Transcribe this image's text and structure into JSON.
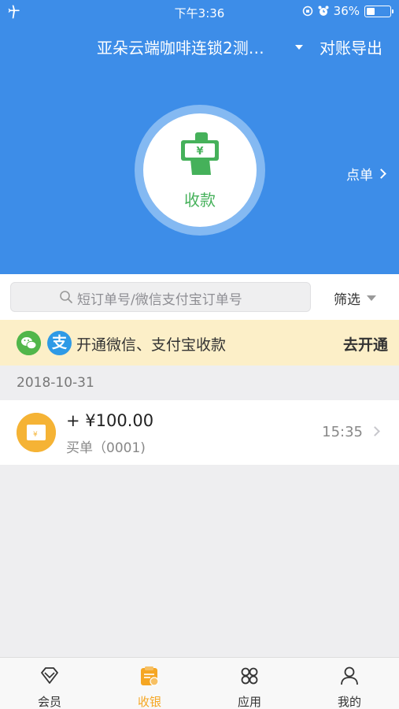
{
  "status_bar": {
    "time": "下午3:36",
    "battery": "36%"
  },
  "header": {
    "store_name": "亚朵云端咖啡连锁2测…",
    "export_label": "对账导出"
  },
  "collect": {
    "label": "收款"
  },
  "order_link": {
    "label": "点单"
  },
  "search": {
    "placeholder": "短订单号/微信支付宝订单号",
    "filter_label": "筛选"
  },
  "banner": {
    "text": "开通微信、支付宝收款",
    "action": "去开通",
    "alipay_glyph": "支"
  },
  "transactions": {
    "date": "2018-10-31",
    "items": [
      {
        "amount": "+ ¥100.00",
        "desc": "买单（0001)",
        "time": "15:35",
        "icon_text": "¥"
      }
    ]
  },
  "tabs": [
    {
      "label": "会员",
      "icon": "diamond-icon"
    },
    {
      "label": "收银",
      "icon": "cashier-icon",
      "active": true
    },
    {
      "label": "应用",
      "icon": "apps-icon"
    },
    {
      "label": "我的",
      "icon": "profile-icon"
    }
  ],
  "colors": {
    "primary": "#3d8de8",
    "accent_green": "#45b15a",
    "tab_active": "#f5a623",
    "banner_bg": "#fcefc8"
  }
}
